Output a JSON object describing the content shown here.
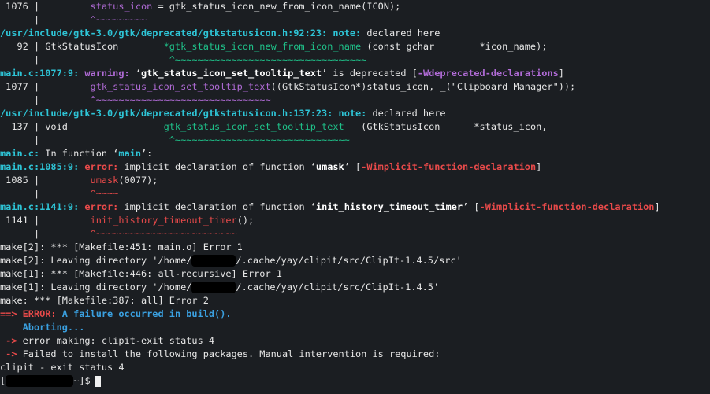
{
  "terminal": {
    "lines": {
      "l1_num": " 1076 |         ",
      "l1_code": "status_icon",
      "l1_rest": " = gtk_status_icon_new_from_icon_name(ICON);",
      "l2_bar": "      |         ",
      "l2_tilde": "^~~~~~~~~~",
      "l3_loc": "/usr/include/gtk-3.0/gtk/deprecated/gtkstatusicon.h:92:23:",
      "l3_note": " note:",
      "l3_msg": " declared here",
      "l4_num": "   92 | GtkStatusIcon        ",
      "l4_fn": "*gtk_status_icon_new_from_icon_name",
      "l4_rest": " (const gchar        *icon_name);",
      "l5_bar": "      |                       ",
      "l5_tilde": "^~~~~~~~~~~~~~~~~~~~~~~~~~~~~~~~~~~",
      "l6_loc": "main.c:1077:9:",
      "l6_warn": " warning:",
      "l6_msg1": " ‘",
      "l6_fn": "gtk_status_icon_set_tooltip_text",
      "l6_msg2": "’ is deprecated [",
      "l6_flag": "-Wdeprecated-declarations",
      "l6_end": "]",
      "l7_num": " 1077 |         ",
      "l7_fn": "gtk_status_icon_set_tooltip_text",
      "l7_rest": "((GtkStatusIcon*)status_icon, _(\"Clipboard Manager\"));",
      "l8_bar": "      |         ",
      "l8_tilde": "^~~~~~~~~~~~~~~~~~~~~~~~~~~~~~~~",
      "l9_loc": "/usr/include/gtk-3.0/gtk/deprecated/gtkstatusicon.h:137:23:",
      "l9_note": " note:",
      "l9_msg": " declared here",
      "l10_num": "  137 | void                 ",
      "l10_fn": "gtk_status_icon_set_tooltip_text",
      "l10_rest": "   (GtkStatusIcon      *status_icon,",
      "l11_bar": "      |                       ",
      "l11_tilde": "^~~~~~~~~~~~~~~~~~~~~~~~~~~~~~~~",
      "l12_loc": "main.c:",
      "l12_msg1": " In function ‘",
      "l12_fn": "main",
      "l12_end": "’:",
      "l13_loc": "main.c:1085:9:",
      "l13_err": " error:",
      "l13_msg1": " implicit declaration of function ‘",
      "l13_fn": "umask",
      "l13_msg2": "’ [",
      "l13_flag": "-Wimplicit-function-declaration",
      "l13_end": "]",
      "l14_num": " 1085 |         ",
      "l14_fn": "umask",
      "l14_rest": "(0077);",
      "l15_bar": "      |         ",
      "l15_tilde": "^~~~~",
      "l16_loc": "main.c:1141:9:",
      "l16_err": " error:",
      "l16_msg1": " implicit declaration of function ‘",
      "l16_fn": "init_history_timeout_timer",
      "l16_msg2": "’ [",
      "l16_flag": "-Wimplicit-function-declaration",
      "l16_end": "]",
      "l17_num": " 1141 |         ",
      "l17_fn": "init_history_timeout_timer",
      "l17_rest": "();",
      "l18_bar": "      |         ",
      "l18_tilde": "^~~~~~~~~~~~~~~~~~~~~~~~~~",
      "l19": "make[2]: *** [Makefile:451: main.o] Error 1",
      "l20a": "make[2]: Leaving directory '/home/",
      "l20b": "/.cache/yay/clipit/src/ClipIt-1.4.5/src'",
      "l21": "make[1]: *** [Makefile:446: all-recursive] Error 1",
      "l22a": "make[1]: Leaving directory '/home/",
      "l22b": "/.cache/yay/clipit/src/ClipIt-1.4.5'",
      "l23": "make: *** [Makefile:387: all] Error 2",
      "l24_arrow": "==>",
      "l24_msg": " ERROR:",
      "l24_rest": " A failure occurred in build().",
      "l25": "    Aborting...",
      "l26_arrow": " ->",
      "l26_rest": " error making: clipit-exit status 4",
      "l27_arrow": " ->",
      "l27_rest": " Failed to install the following packages. Manual intervention is required:",
      "l28": "clipit - exit status 4",
      "l29_open": "[",
      "l29_close": "~]$"
    },
    "colors": {
      "background": "#1b1e22",
      "purple": "#b06bd6",
      "green": "#1fc28a",
      "red": "#e84a4a",
      "cyan": "#2ec4d6",
      "blue": "#4a86e8"
    }
  }
}
